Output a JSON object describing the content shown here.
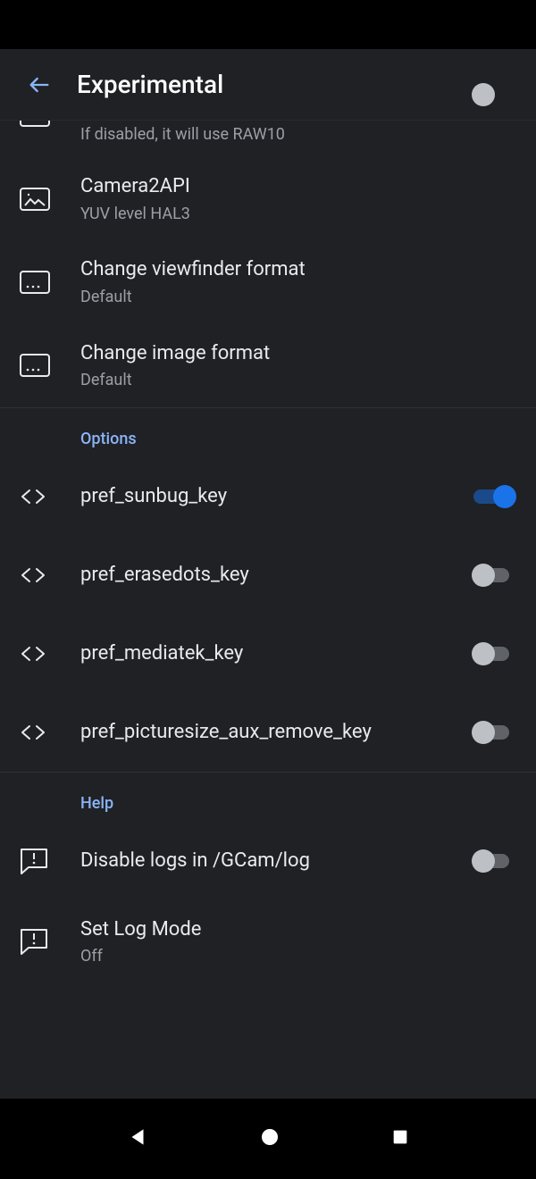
{
  "header": {
    "title": "Experimental"
  },
  "partial_top": {
    "subtitle": "If disabled, it will use RAW10"
  },
  "items": {
    "camera2api": {
      "title": "Camera2API",
      "subtitle": "YUV level HAL3"
    },
    "viewfinder": {
      "title": "Change viewfinder format",
      "subtitle": "Default"
    },
    "imageformat": {
      "title": "Change image format",
      "subtitle": "Default"
    }
  },
  "sections": {
    "options": {
      "label": "Options"
    },
    "help": {
      "label": "Help"
    }
  },
  "options": {
    "sunbug": {
      "title": "pref_sunbug_key",
      "on": true
    },
    "erasedots": {
      "title": "pref_erasedots_key",
      "on": false
    },
    "mediatek": {
      "title": "pref_mediatek_key",
      "on": false
    },
    "picsize": {
      "title": "pref_picturesize_aux_remove_key",
      "on": false
    }
  },
  "help": {
    "disablelogs": {
      "title": "Disable logs in /GCam/log",
      "on": false
    },
    "setlogmode": {
      "title": "Set Log Mode",
      "subtitle": "Off"
    }
  }
}
